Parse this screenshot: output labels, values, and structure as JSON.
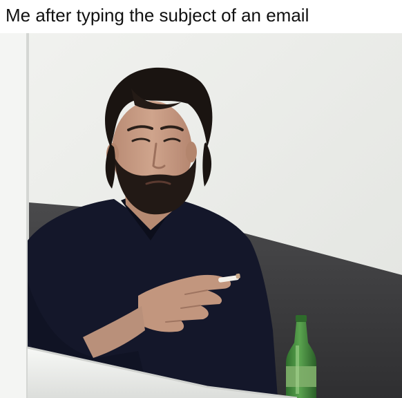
{
  "meme": {
    "caption": "Me after typing the subject of an email"
  },
  "photo": {
    "subject": "person",
    "objects": [
      "cigarette",
      "bottle"
    ],
    "colors": {
      "wall": "#eceeea",
      "sweater": "#14172a",
      "hair": "#1a1411",
      "skin": "#c59a82",
      "bottle": "#3f8a3a",
      "railing": "#f2f3f1",
      "shadow": "#3b3b3d"
    }
  }
}
